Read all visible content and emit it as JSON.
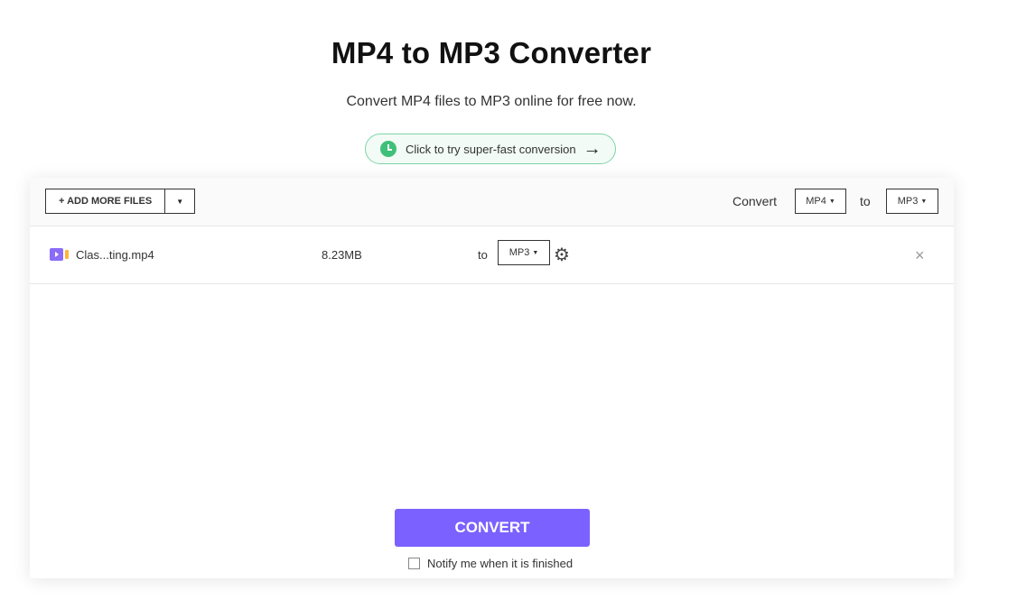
{
  "header": {
    "title": "MP4 to MP3 Converter",
    "subtitle": "Convert MP4 files to MP3 online for free now.",
    "promo_label": "Click to try super-fast conversion",
    "promo_icon": "clock-icon",
    "promo_arrow": "→"
  },
  "toolbar": {
    "add_files_label": "+ ADD MORE FILES",
    "dropdown_caret": "▼",
    "convert_label": "Convert",
    "from_format": "MP4",
    "to_label": "to",
    "to_format": "MP3"
  },
  "files": [
    {
      "name": "Clas...ting.mp4",
      "size": "8.23MB",
      "to_label": "to",
      "format": "MP3",
      "settings_icon": "⚙",
      "remove_icon": "×"
    }
  ],
  "actions": {
    "convert_button": "CONVERT",
    "notify_label": "Notify me when it is finished",
    "notify_checked": false
  },
  "colors": {
    "accent": "#7b61ff",
    "promo_green": "#3fbf7a",
    "video_icon": "#8b6cf7"
  }
}
